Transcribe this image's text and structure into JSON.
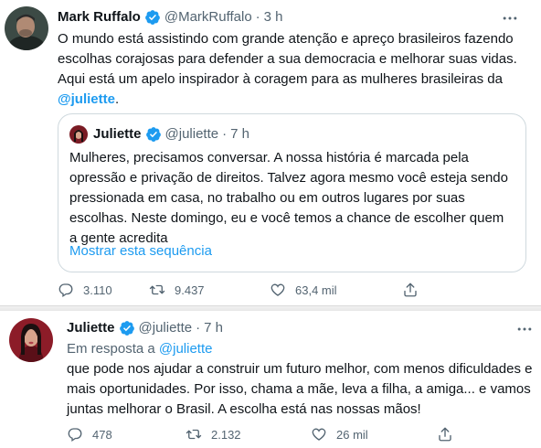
{
  "tweet1": {
    "name": "Mark Ruffalo",
    "handle": "@MarkRuffalo",
    "separator": "·",
    "time": "3 h",
    "text": "O mundo está assistindo com grande atenção e apreço brasileiros fazendo escolhas corajosas para defender a sua democracia e melhorar suas vidas. Aqui está um apelo inspirador à coragem para as mulheres brasileiras da",
    "mention": "@juliette",
    "text_end": ".",
    "quote": {
      "name": "Juliette",
      "handle": "@juliette",
      "separator": "·",
      "time": "7 h",
      "text": "Mulheres, precisamos conversar. A nossa história é marcada pela opressão e privação de direitos. Talvez agora mesmo você esteja sendo pressionada em casa, no trabalho ou em outros lugares por suas escolhas. Neste domingo, eu e você temos a chance de escolher quem a gente acredita",
      "show_thread": "Mostrar esta sequência"
    },
    "stats": {
      "replies": "3.110",
      "retweets": "9.437",
      "likes": "63,4 mil"
    }
  },
  "tweet2": {
    "name": "Juliette",
    "handle": "@juliette",
    "separator": "·",
    "time": "7 h",
    "reply_prefix": "Em resposta a",
    "reply_handle": "@juliette",
    "text": "que pode nos ajudar a construir um futuro melhor, com menos dificuldades e mais oportunidades. Por isso, chama a mãe, leva a filha, a amiga... e vamos juntas melhorar o Brasil. A escolha está nas nossas mãos!",
    "stats": {
      "replies": "478",
      "retweets": "2.132",
      "likes": "26 mil"
    }
  },
  "colors": {
    "accent": "#1d9bf0",
    "secondary_text": "#536471",
    "border": "#cfd9de"
  },
  "icons": [
    "verified-badge-icon",
    "more-icon",
    "reply-icon",
    "retweet-icon",
    "like-icon",
    "share-icon"
  ]
}
